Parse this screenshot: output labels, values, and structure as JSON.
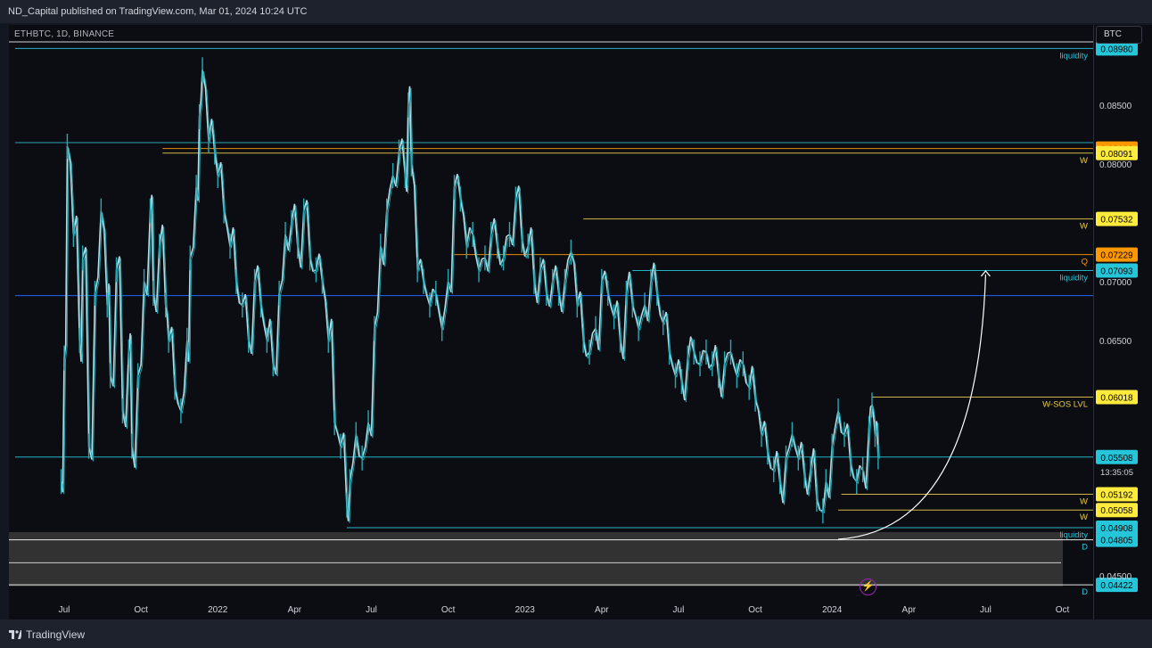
{
  "header": {
    "published": "ND_Capital published on TradingView.com, Mar 01, 2024 10:24 UTC"
  },
  "symbol_line": "ETHBTC, 1D, BINANCE",
  "currency_button": "BTC",
  "footer": {
    "brand": "TradingView"
  },
  "icons": {
    "brand_icon": "tradingview-logo-icon",
    "flash": "lightning-icon"
  },
  "colors": {
    "candle": "#26a8b5",
    "candle_light": "#b2dfe6",
    "cyan_line": "#26c6da",
    "yellow_line": "#e6c84a",
    "orange_line": "#ff9800",
    "blue_line": "#2962ff",
    "white_curve": "#ffffff",
    "zone_fill": "#3a3a3a"
  },
  "chart_data": {
    "type": "line",
    "series": [
      {
        "values": [
          [
            2021.49,
            0.053
          ],
          [
            2021.5,
            0.0635
          ],
          [
            2021.51,
            0.0815
          ],
          [
            2021.53,
            0.074
          ],
          [
            2021.55,
            0.065
          ],
          [
            2021.56,
            0.072
          ],
          [
            2021.58,
            0.056
          ],
          [
            2021.6,
            0.069
          ],
          [
            2021.62,
            0.076
          ],
          [
            2021.64,
            0.068
          ],
          [
            2021.65,
            0.062
          ],
          [
            2021.67,
            0.071
          ],
          [
            2021.69,
            0.059
          ],
          [
            2021.71,
            0.064
          ],
          [
            2021.72,
            0.056
          ],
          [
            2021.74,
            0.062
          ],
          [
            2021.76,
            0.07
          ],
          [
            2021.78,
            0.076
          ],
          [
            2021.79,
            0.069
          ],
          [
            2021.81,
            0.073
          ],
          [
            2021.83,
            0.068
          ],
          [
            2021.84,
            0.065
          ],
          [
            2021.86,
            0.061
          ],
          [
            2021.88,
            0.059
          ],
          [
            2021.9,
            0.065
          ],
          [
            2021.91,
            0.072
          ],
          [
            2021.93,
            0.078
          ],
          [
            2021.94,
            0.084
          ],
          [
            2021.95,
            0.088
          ],
          [
            2021.97,
            0.082
          ],
          [
            2021.99,
            0.081
          ],
          [
            2022.0,
            0.079
          ],
          [
            2022.02,
            0.076
          ],
          [
            2022.04,
            0.073
          ],
          [
            2022.06,
            0.07
          ],
          [
            2022.08,
            0.068
          ],
          [
            2022.1,
            0.065
          ],
          [
            2022.12,
            0.07
          ],
          [
            2022.14,
            0.068
          ],
          [
            2022.16,
            0.065
          ],
          [
            2022.18,
            0.063
          ],
          [
            2022.2,
            0.069
          ],
          [
            2022.22,
            0.074
          ],
          [
            2022.24,
            0.075
          ],
          [
            2022.26,
            0.073
          ],
          [
            2022.28,
            0.076
          ],
          [
            2022.3,
            0.072
          ],
          [
            2022.32,
            0.071
          ],
          [
            2022.34,
            0.07
          ],
          [
            2022.36,
            0.065
          ],
          [
            2022.38,
            0.058
          ],
          [
            2022.4,
            0.056
          ],
          [
            2022.42,
            0.051
          ],
          [
            2022.43,
            0.053
          ],
          [
            2022.45,
            0.057
          ],
          [
            2022.47,
            0.055
          ],
          [
            2022.49,
            0.058
          ],
          [
            2022.51,
            0.066
          ],
          [
            2022.53,
            0.073
          ],
          [
            2022.55,
            0.076
          ],
          [
            2022.57,
            0.079
          ],
          [
            2022.59,
            0.081
          ],
          [
            2022.61,
            0.079
          ],
          [
            2022.62,
            0.085
          ],
          [
            2022.63,
            0.08
          ],
          [
            2022.65,
            0.071
          ],
          [
            2022.67,
            0.07
          ],
          [
            2022.69,
            0.068
          ],
          [
            2022.71,
            0.069
          ],
          [
            2022.73,
            0.066
          ],
          [
            2022.75,
            0.07
          ],
          [
            2022.77,
            0.078
          ],
          [
            2022.79,
            0.077
          ],
          [
            2022.81,
            0.073
          ],
          [
            2022.83,
            0.074
          ],
          [
            2022.85,
            0.071
          ],
          [
            2022.87,
            0.072
          ],
          [
            2022.89,
            0.074
          ],
          [
            2022.91,
            0.073
          ],
          [
            2022.93,
            0.072
          ],
          [
            2022.95,
            0.074
          ],
          [
            2022.97,
            0.077
          ],
          [
            2022.99,
            0.0735
          ],
          [
            2023.01,
            0.073
          ],
          [
            2023.03,
            0.07
          ],
          [
            2023.05,
            0.071
          ],
          [
            2023.07,
            0.069
          ],
          [
            2023.09,
            0.07
          ],
          [
            2023.11,
            0.069
          ],
          [
            2023.13,
            0.07
          ],
          [
            2023.15,
            0.0725
          ],
          [
            2023.17,
            0.068
          ],
          [
            2023.19,
            0.065
          ],
          [
            2023.21,
            0.064
          ],
          [
            2023.23,
            0.066
          ],
          [
            2023.25,
            0.07
          ],
          [
            2023.27,
            0.069
          ],
          [
            2023.29,
            0.067
          ],
          [
            2023.31,
            0.065
          ],
          [
            2023.33,
            0.069
          ],
          [
            2023.35,
            0.068
          ],
          [
            2023.37,
            0.066
          ],
          [
            2023.39,
            0.068
          ],
          [
            2023.41,
            0.07
          ],
          [
            2023.43,
            0.069
          ],
          [
            2023.45,
            0.0665
          ],
          [
            2023.47,
            0.064
          ],
          [
            2023.49,
            0.062
          ],
          [
            2023.51,
            0.0615
          ],
          [
            2023.53,
            0.0635
          ],
          [
            2023.55,
            0.064
          ],
          [
            2023.57,
            0.063
          ],
          [
            2023.59,
            0.064
          ],
          [
            2023.61,
            0.063
          ],
          [
            2023.63,
            0.062
          ],
          [
            2023.65,
            0.063
          ],
          [
            2023.67,
            0.064
          ],
          [
            2023.69,
            0.062
          ],
          [
            2023.71,
            0.063
          ],
          [
            2023.73,
            0.061
          ],
          [
            2023.75,
            0.06
          ],
          [
            2023.77,
            0.057
          ],
          [
            2023.79,
            0.0555
          ],
          [
            2023.81,
            0.054
          ],
          [
            2023.83,
            0.053
          ],
          [
            2023.85,
            0.055
          ],
          [
            2023.87,
            0.057
          ],
          [
            2023.89,
            0.055
          ],
          [
            2023.91,
            0.0535
          ],
          [
            2023.93,
            0.054
          ],
          [
            2023.95,
            0.0515
          ],
          [
            2023.97,
            0.0505
          ],
          [
            2023.98,
            0.053
          ],
          [
            2024.0,
            0.056
          ],
          [
            2024.02,
            0.059
          ],
          [
            2024.04,
            0.057
          ],
          [
            2024.06,
            0.0545
          ],
          [
            2024.08,
            0.053
          ],
          [
            2024.1,
            0.054
          ],
          [
            2024.12,
            0.0575
          ],
          [
            2024.13,
            0.0595
          ],
          [
            2024.14,
            0.057
          ],
          [
            2024.15,
            0.0551
          ]
        ]
      }
    ],
    "x_ticks": [
      {
        "label": "Jul",
        "x": 2021.5
      },
      {
        "label": "Oct",
        "x": 2021.75
      },
      {
        "label": "2022",
        "x": 2022.0
      },
      {
        "label": "Apr",
        "x": 2022.25
      },
      {
        "label": "Jul",
        "x": 2022.5
      },
      {
        "label": "Oct",
        "x": 2022.75
      },
      {
        "label": "2023",
        "x": 2023.0
      },
      {
        "label": "Apr",
        "x": 2023.25
      },
      {
        "label": "Jul",
        "x": 2023.5
      },
      {
        "label": "Oct",
        "x": 2023.75
      },
      {
        "label": "2024",
        "x": 2024.0
      },
      {
        "label": "Apr",
        "x": 2024.25
      },
      {
        "label": "Jul",
        "x": 2024.5
      },
      {
        "label": "Oct",
        "x": 2024.75
      }
    ],
    "y_ticks": [
      0.085,
      0.08,
      0.07,
      0.065,
      0.045
    ],
    "y_tick_labels": [
      "0.08500",
      "0.08000",
      "0.07000",
      "0.06500",
      "0.04500"
    ],
    "xlim": [
      2021.32,
      2024.85
    ],
    "ylim": [
      0.0434,
      0.0918
    ],
    "levels": [
      {
        "value": 0.0898,
        "label": "0.08980",
        "tag": "liquidity",
        "color": "#26c6da",
        "box": "#26c6da",
        "x0": 2021.34
      },
      {
        "value": 0.0813,
        "label": "0.08130",
        "tag": "",
        "color": "#ff9800",
        "box": "#ff9800",
        "x0": 2021.82
      },
      {
        "value": 0.08091,
        "label": "0.08091",
        "tag": "W",
        "color": "#e6c84a",
        "box": "#ffeb3b",
        "x0": 2021.82
      },
      {
        "value": 0.07532,
        "label": "0.07532",
        "tag": "W",
        "color": "#e6c84a",
        "box": "#ffeb3b",
        "x0": 2023.19
      },
      {
        "value": 0.07229,
        "label": "0.07229",
        "tag": "Q",
        "color": "#ff9800",
        "box": "#ff9800",
        "x0": 2022.77
      },
      {
        "value": 0.07093,
        "label": "0.07093",
        "tag": "liquidity",
        "color": "#26c6da",
        "box": "#26c6da",
        "x0": 2023.35
      },
      {
        "value": 0.06018,
        "label": "0.06018",
        "tag": "W-SOS LVL",
        "color": "#e6c84a",
        "box": "#ffeb3b",
        "x0": 2024.13
      },
      {
        "value": 0.05508,
        "label": "0.05508",
        "tag": "",
        "color": "#26c6da",
        "box": "#26c6da",
        "x0": 2021.34
      },
      {
        "value": 0.05192,
        "label": "0.05192",
        "tag": "W",
        "color": "#e6c84a",
        "box": "#ffeb3b",
        "x0": 2024.03
      },
      {
        "value": 0.05058,
        "label": "0.05058",
        "tag": "W",
        "color": "#e6c84a",
        "box": "#ffeb3b",
        "x0": 2024.02
      },
      {
        "value": 0.04908,
        "label": "0.04908",
        "tag": "liquidity",
        "color": "#26c6da",
        "box": "#26c6da",
        "x0": 2022.42
      },
      {
        "value": 0.04805,
        "label": "0.04805",
        "tag": "D",
        "color": "#ffffff",
        "box": "#26c6da",
        "x0": 2021.32
      },
      {
        "value": 0.04422,
        "label": "0.04422",
        "tag": "D",
        "color": "#ffffff",
        "box": "#26c6da",
        "x0": 2021.32
      }
    ],
    "countdown": "13:35:05",
    "extra_lines": [
      {
        "value": 0.0818,
        "x0": 2021.34,
        "color": "#26a8b5"
      },
      {
        "value": 0.0688,
        "x0": 2021.34,
        "color": "#2962ff"
      }
    ],
    "zone": {
      "from": 0.0441,
      "to": 0.0487
    },
    "projection": {
      "from": [
        2024.02,
        0.0481
      ],
      "to": [
        2024.5,
        0.0709
      ]
    }
  }
}
